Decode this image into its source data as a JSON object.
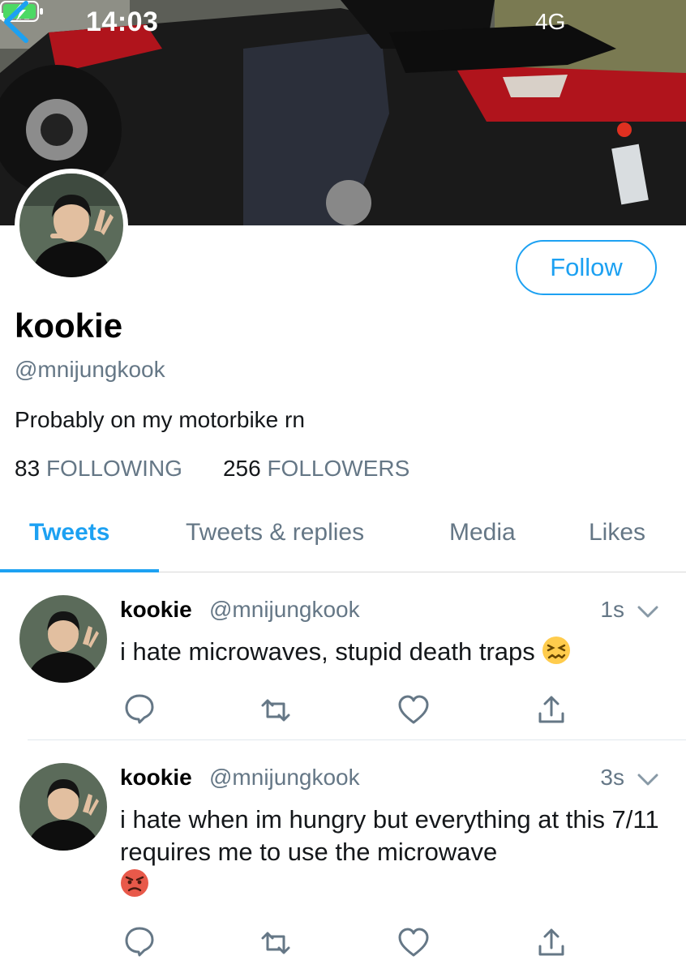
{
  "status_bar": {
    "time": "14:03",
    "network": "4G"
  },
  "profile": {
    "display_name": "kookie",
    "handle": "@mnijungkook",
    "bio": "Probably on my motorbike rn",
    "follow_label": "Follow",
    "following_count": "83",
    "following_label": "FOLLOWING",
    "followers_count": "256",
    "followers_label": "FOLLOWERS"
  },
  "tabs": [
    {
      "label": "Tweets",
      "active": true
    },
    {
      "label": "Tweets & replies",
      "active": false
    },
    {
      "label": "Media",
      "active": false
    },
    {
      "label": "Likes",
      "active": false
    }
  ],
  "tweets": [
    {
      "name": "kookie",
      "handle": "@mnijungkook",
      "time": "1s",
      "text": "i hate microwaves, stupid death traps",
      "emoji": "confounded-face"
    },
    {
      "name": "kookie",
      "handle": "@mnijungkook",
      "time": "3s",
      "text": "i hate when im hungry but everything at this 7/11 requires me to use the microwave",
      "emoji": "pouting-face"
    }
  ],
  "colors": {
    "accent": "#1da1f2",
    "secondary_text": "#657786",
    "divider": "#e1e8ed"
  }
}
